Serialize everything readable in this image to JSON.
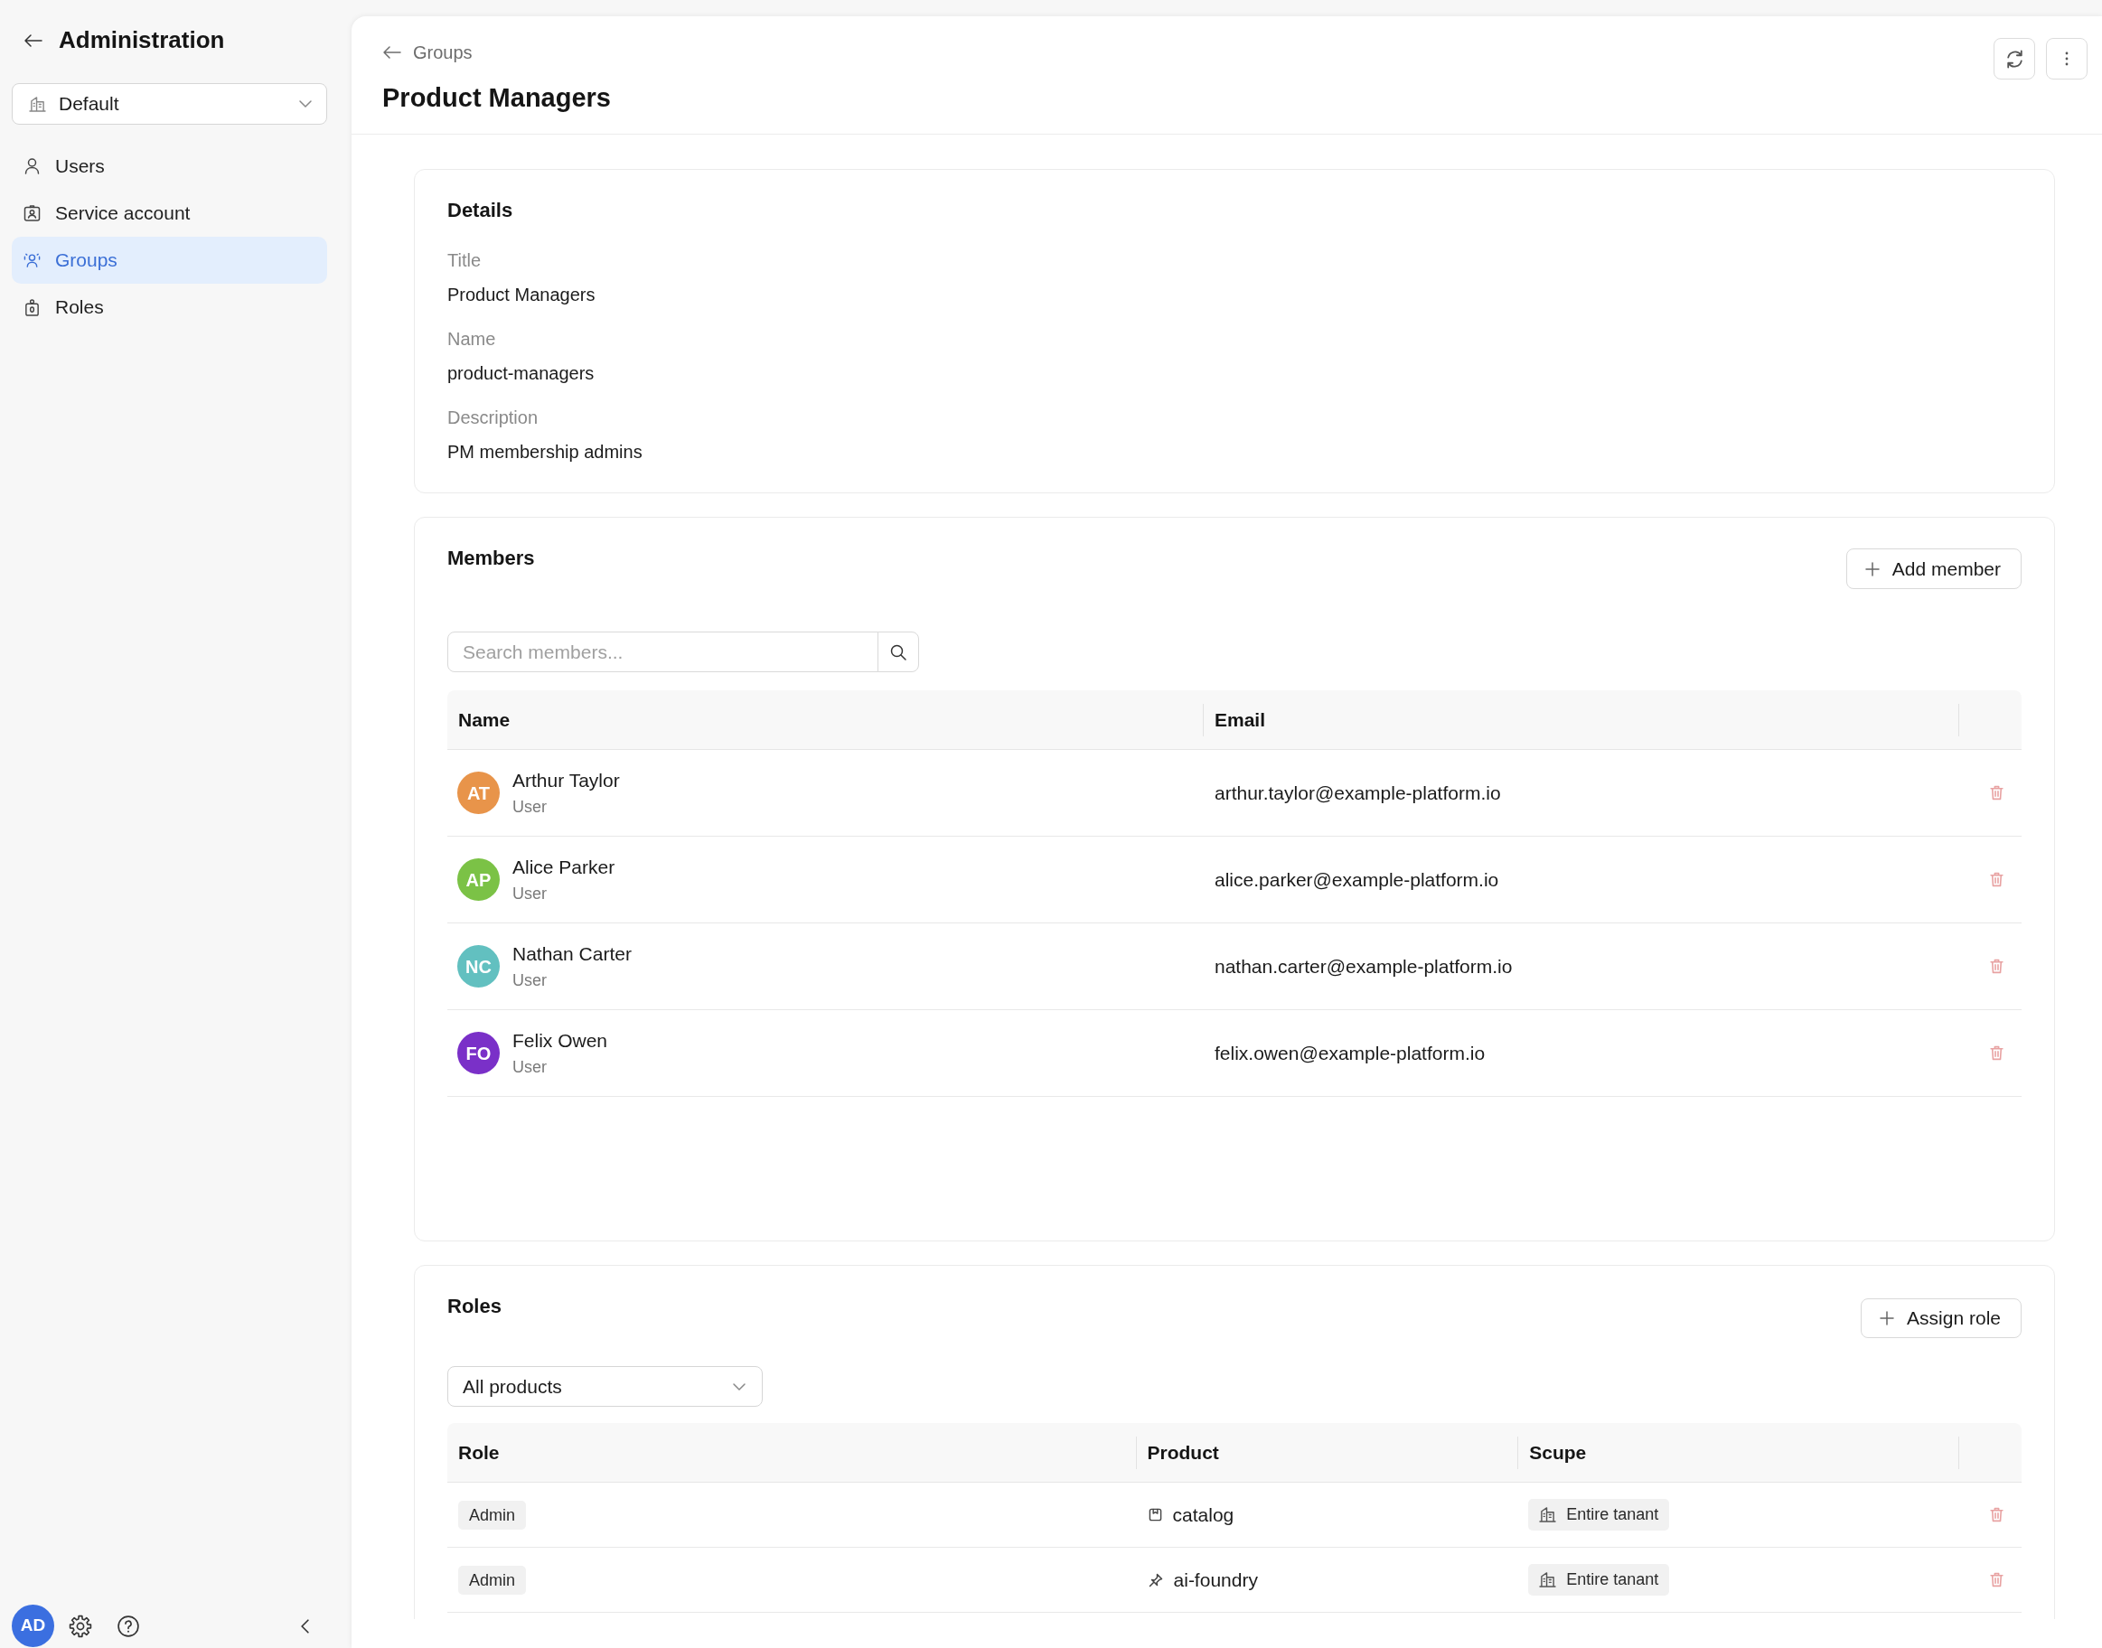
{
  "sidebar": {
    "title": "Administration",
    "tenant": {
      "value": "Default"
    },
    "items": [
      {
        "label": "Users",
        "selected": false
      },
      {
        "label": "Service account",
        "selected": false
      },
      {
        "label": "Groups",
        "selected": true
      },
      {
        "label": "Roles",
        "selected": false
      }
    ],
    "user_avatar": "AD"
  },
  "header": {
    "breadcrumb": "Groups",
    "title": "Product Managers"
  },
  "details": {
    "title": "Details",
    "fields": [
      {
        "label": "Title",
        "value": "Product Managers"
      },
      {
        "label": "Name",
        "value": "product-managers"
      },
      {
        "label": "Description",
        "value": "PM membership admins"
      }
    ]
  },
  "members": {
    "title": "Members",
    "add_button": "Add member",
    "search": {
      "placeholder": "Search members..."
    },
    "columns": [
      "Name",
      "Email"
    ],
    "rows": [
      {
        "initials": "AT",
        "color": "#e8944a",
        "name": "Arthur Taylor",
        "type": "User",
        "email": "arthur.taylor@example-platform.io"
      },
      {
        "initials": "AP",
        "color": "#7bc246",
        "name": "Alice Parker",
        "type": "User",
        "email": "alice.parker@example-platform.io"
      },
      {
        "initials": "NC",
        "color": "#62c0c0",
        "name": "Nathan Carter",
        "type": "User",
        "email": "nathan.carter@example-platform.io"
      },
      {
        "initials": "FO",
        "color": "#7a30c8",
        "name": "Felix Owen",
        "type": "User",
        "email": "felix.owen@example-platform.io"
      }
    ]
  },
  "roles": {
    "title": "Roles",
    "assign_button": "Assign role",
    "filter": {
      "value": "All products"
    },
    "columns": [
      "Role",
      "Product",
      "Scupe"
    ],
    "rows": [
      {
        "role": "Admin",
        "product": "catalog",
        "scope": "Entire tanant"
      },
      {
        "role": "Admin",
        "product": "ai-foundry",
        "scope": "Entire tanant"
      }
    ]
  }
}
